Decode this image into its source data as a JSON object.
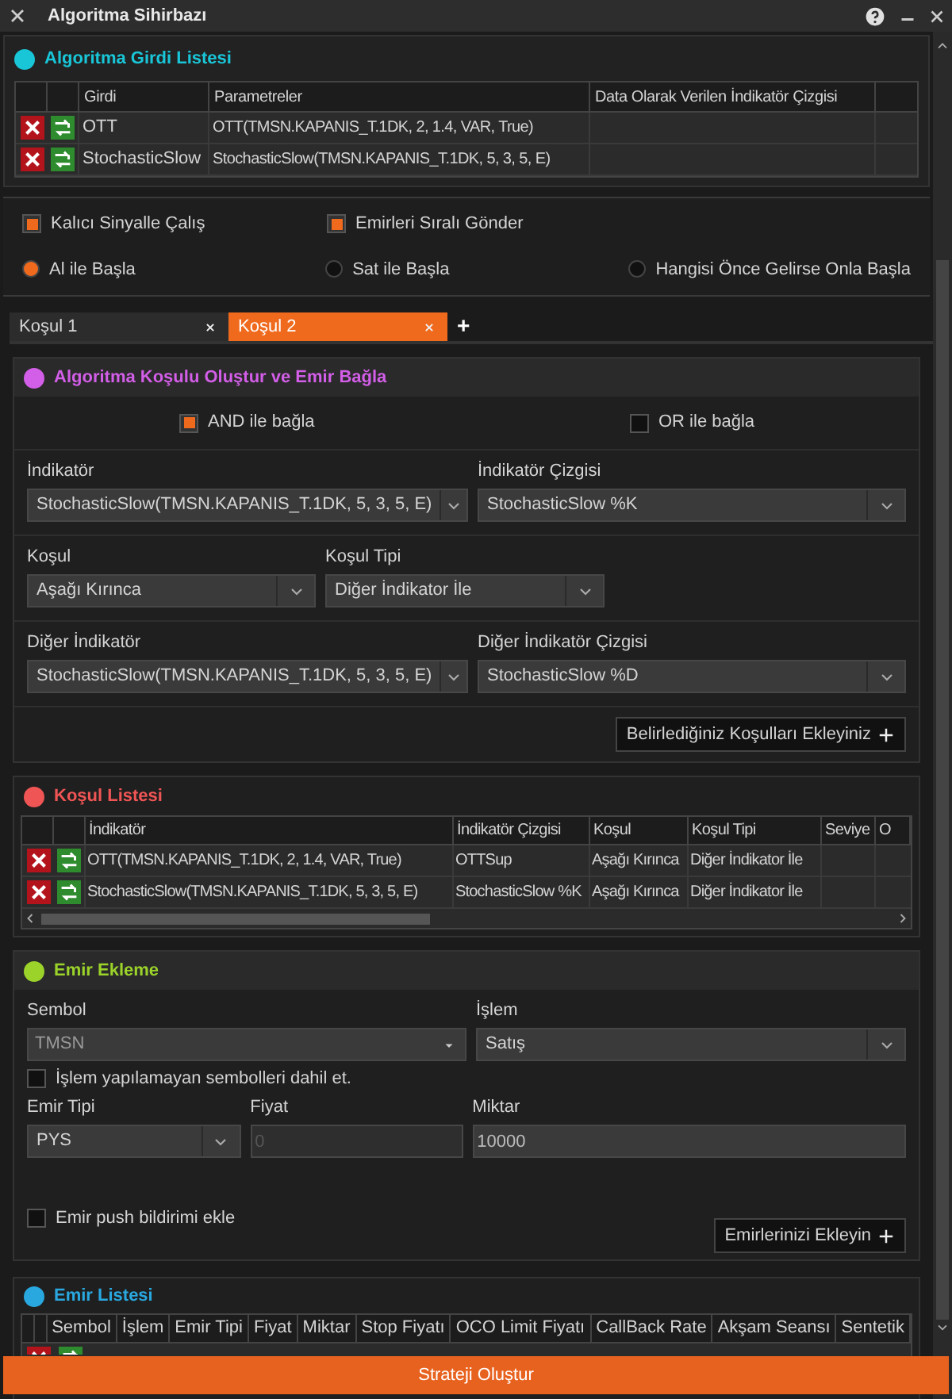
{
  "window": {
    "title": "Algoritma Sihirbazı"
  },
  "input_list": {
    "title": "Algoritma Girdi Listesi",
    "columns": [
      "Girdi",
      "Parametreler",
      "Data Olarak Verilen İndikatör Çizgisi"
    ],
    "rows": [
      {
        "girdi": "OTT",
        "parametreler": "OTT(TMSN.KAPANIS_T.1DK, 2, 1.4, VAR, True)"
      },
      {
        "girdi": "StochasticSlow",
        "parametreler": "StochasticSlow(TMSN.KAPANIS_T.1DK, 5, 3, 5, E)"
      }
    ]
  },
  "options": {
    "checkboxes": [
      {
        "label": "Kalıcı Sinyalle Çalış",
        "checked": true
      },
      {
        "label": "Emirleri Sıralı Gönder",
        "checked": true
      }
    ],
    "radios": [
      {
        "label": "Al ile Başla",
        "selected": true
      },
      {
        "label": "Sat ile Başla",
        "selected": false
      },
      {
        "label": "Hangisi Önce Gelirse Onla Başla",
        "selected": false
      }
    ]
  },
  "tabs": [
    {
      "label": "Koşul 1",
      "selected": false
    },
    {
      "label": "Koşul 2",
      "selected": true
    }
  ],
  "add_tab": "+",
  "condition_builder": {
    "title": "Algoritma Koşulu Oluştur ve Emir Bağla",
    "connectors": [
      {
        "label": "AND ile bağla",
        "checked": true
      },
      {
        "label": "OR ile bağla",
        "checked": false
      }
    ],
    "indicator": {
      "label": "İndikatör",
      "value": "StochasticSlow(TMSN.KAPANIS_T.1DK, 5, 3, 5, E)"
    },
    "indicator_line": {
      "label": "İndikatör Çizgisi",
      "value": "StochasticSlow %K"
    },
    "condition": {
      "label": "Koşul",
      "value": "Aşağı Kırınca"
    },
    "condition_type": {
      "label": "Koşul Tipi",
      "value": "Diğer İndikator İle"
    },
    "other_indicator": {
      "label": "Diğer İndikatör",
      "value": "StochasticSlow(TMSN.KAPANIS_T.1DK, 5, 3, 5, E)"
    },
    "other_indicator_line": {
      "label": "Diğer İndikatör Çizgisi",
      "value": "StochasticSlow %D"
    },
    "add_button": "Belirlediğiniz Koşulları Ekleyiniz"
  },
  "condition_list": {
    "title": "Koşul Listesi",
    "columns": [
      "İndikatör",
      "İndikatör Çizgisi",
      "Koşul",
      "Koşul Tipi",
      "Seviye",
      "O"
    ],
    "rows": [
      {
        "indikator": "OTT(TMSN.KAPANIS_T.1DK, 2, 1.4, VAR, True)",
        "cizgi": "OTTSup",
        "kosul": "Aşağı Kırınca",
        "kosul_tipi": "Diğer İndikator İle"
      },
      {
        "indikator": "StochasticSlow(TMSN.KAPANIS_T.1DK, 5, 3, 5, E)",
        "cizgi": "StochasticSlow %K",
        "kosul": "Aşağı Kırınca",
        "kosul_tipi": "Diğer İndikator İle"
      }
    ]
  },
  "order_entry": {
    "title": "Emir Ekleme",
    "symbol": {
      "label": "Sembol",
      "value": "TMSN"
    },
    "operation": {
      "label": "İşlem",
      "value": "Satış"
    },
    "include_untradable": {
      "label": "İşlem yapılamayan sembolleri dahil et.",
      "checked": false
    },
    "order_type": {
      "label": "Emir Tipi",
      "value": "PYS"
    },
    "price": {
      "label": "Fiyat",
      "placeholder": "0",
      "disabled": true
    },
    "quantity": {
      "label": "Miktar",
      "value": "10000"
    },
    "push_notification": {
      "label": "Emir push bildirimi ekle",
      "checked": false
    },
    "add_button": "Emirlerinizi Ekleyin"
  },
  "order_list": {
    "title": "Emir Listesi",
    "columns": [
      "Sembol",
      "İşlem",
      "Emir Tipi",
      "Fiyat",
      "Miktar",
      "Stop Fiyatı",
      "OCO Limit Fiyatı",
      "CallBack Rate",
      "Akşam Seansı",
      "Sentetik"
    ]
  },
  "create_button": "Strateji Oluştur"
}
